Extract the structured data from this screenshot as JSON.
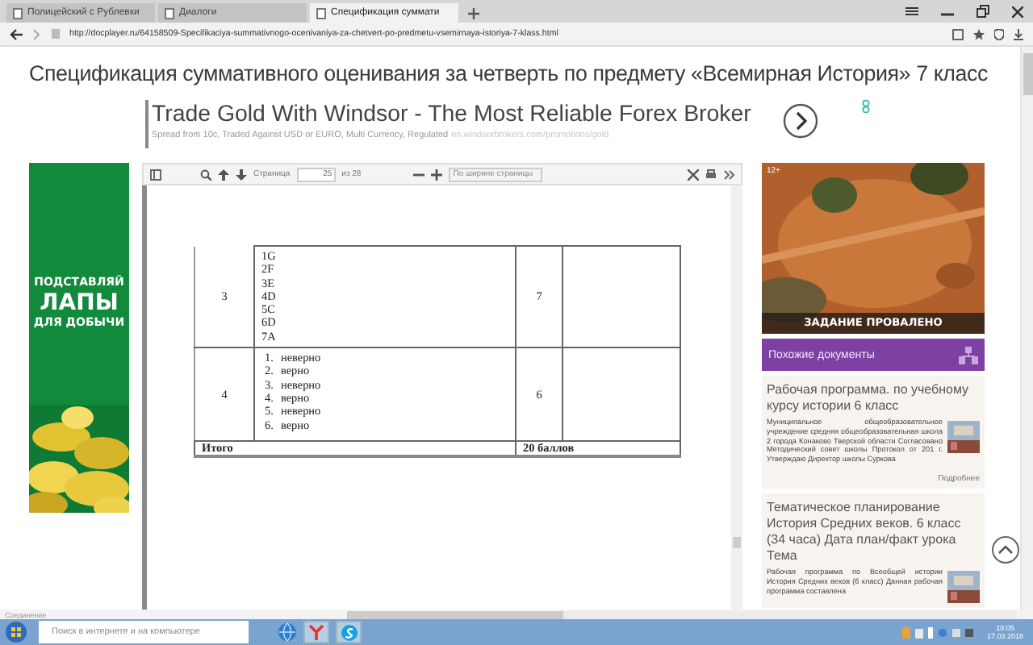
{
  "browser": {
    "tabs": [
      {
        "label": "Полицейский с Рублевки",
        "selected": false
      },
      {
        "label": "Диалоги",
        "selected": false
      },
      {
        "label": "Спецификация суммати",
        "selected": true
      }
    ],
    "url": "http://docplayer.ru/64158509-Specifikaciya-summativnogo-ocenivaniya-za-chetvert-po-predmetu-vsemirnaya-istoriya-7-klass.html"
  },
  "page": {
    "title": "Спецификация суммативного оценивания за четверть по предмету «Всемирная История» 7 класс",
    "ad": {
      "title": "Trade Gold With Windsor - The Most Reliable Forex Broker",
      "subtitle": "Spread from 10c, Traded Against USD or EURO, Multi Currency, Regulated",
      "link": "en.windsorbrokers.com/promotions/gold"
    },
    "left_ad": {
      "lines": [
        "ПОДСТАВЛЯЙ",
        "ЛАПЫ",
        "ДЛЯ ДОБЫЧИ"
      ]
    },
    "viewer": {
      "page_label": "Страница",
      "page": "25",
      "page_total": "из 28",
      "zoom": "По ширине страницы",
      "table": {
        "rows": [
          {
            "number": "3",
            "answers": [
              {
                "text": "1G"
              },
              {
                "text": "2F"
              },
              {
                "text": "3E"
              },
              {
                "text": "4D"
              },
              {
                "text": "5C"
              },
              {
                "text": "6D"
              },
              {
                "text": "7A"
              }
            ],
            "score": "7"
          },
          {
            "number": "4",
            "answers": [
              {
                "num": "1.",
                "text": "неверно"
              },
              {
                "num": "2.",
                "text": "верно"
              },
              {
                "num": "3.",
                "text": "неверно"
              },
              {
                "num": "4.",
                "text": "верно"
              },
              {
                "num": "5.",
                "text": "неверно"
              },
              {
                "num": "6.",
                "text": "верно"
              }
            ],
            "score": "6"
          }
        ],
        "total": {
          "label": "Итого",
          "value": "20 баллов"
        }
      }
    },
    "right_ad": {
      "badge": "12+",
      "caption": "ЗАДАНИЕ ПРОВАЛЕНО"
    },
    "similar": {
      "title": "Похожие документы",
      "items": [
        {
          "title": "Рабочая программа. по учебному курсу истории 6 класс",
          "description": "Муниципальное общеобразовательное учреждение средняя общеобразовательная школа 2 города Конаково Тверской области Согласовано Методический совет школы Протокол от 201 г. Утверждаю Директор школы Суркова",
          "more": "Подробнее"
        },
        {
          "title": "Тематическое планирование История Средних веков. 6 класс (34 часа) Дата план/факт урока Тема",
          "description": "Рабочая программа по Всеобщей истории История Средних веков (6 класс) Данная рабочая программа составлена"
        }
      ]
    }
  },
  "status": "Соединение",
  "taskbar": {
    "search_placeholder": "Поиск в интернете и на компьютере",
    "time": "18:05",
    "date": "17.03.2018"
  }
}
